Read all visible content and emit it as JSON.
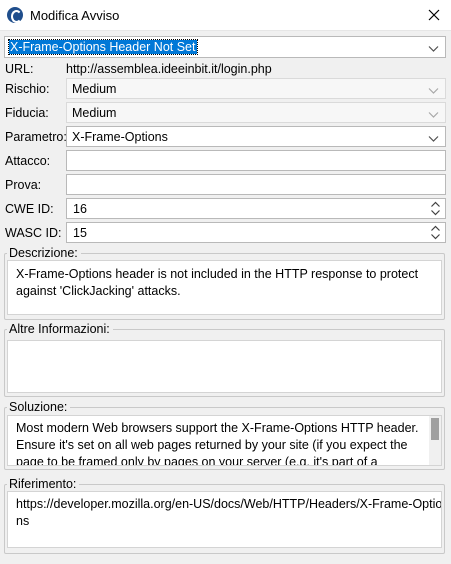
{
  "window": {
    "title": "Modifica Avviso"
  },
  "alert": {
    "name": "X-Frame-Options Header Not Set",
    "url_label": "URL:",
    "url": "http://assemblea.ideeinbit.it/login.php",
    "risk_label": "Rischio:",
    "risk": "Medium",
    "confidence_label": "Fiducia:",
    "confidence": "Medium",
    "param_label": "Parametro:",
    "param": "X-Frame-Options",
    "attack_label": "Attacco:",
    "attack": "",
    "evidence_label": "Prova:",
    "evidence": "",
    "cwe_label": "CWE ID:",
    "cwe": "16",
    "wasc_label": "WASC ID:",
    "wasc": "15"
  },
  "description": {
    "label": "Descrizione:",
    "lines": [
      "X-Frame-Options header is not included in the HTTP response to protect",
      "against 'ClickJacking' attacks."
    ]
  },
  "other_info": {
    "label": "Altre Informazioni:",
    "text": ""
  },
  "solution": {
    "label": "Soluzione:",
    "lines": [
      "Most modern Web browsers support the X-Frame-Options HTTP header.",
      "Ensure it's set on all web pages returned by your site (if you expect the",
      "page to be framed only by pages on your server (e.g. it's part of a"
    ]
  },
  "reference": {
    "label": "Riferimento:",
    "lines": [
      "https://developer.mozilla.org/en-US/docs/Web/HTTP/Headers/X-Frame-Optio",
      "ns"
    ]
  },
  "icons": {
    "app": "zap-app-icon",
    "close": "close-icon",
    "dropdown": "chevron-down-icon",
    "spinner": "spinner-arrows-icon"
  },
  "colors": {
    "selection": "#0078d7",
    "window_bg": "#f0f0f0",
    "field_bg": "#ffffff"
  }
}
